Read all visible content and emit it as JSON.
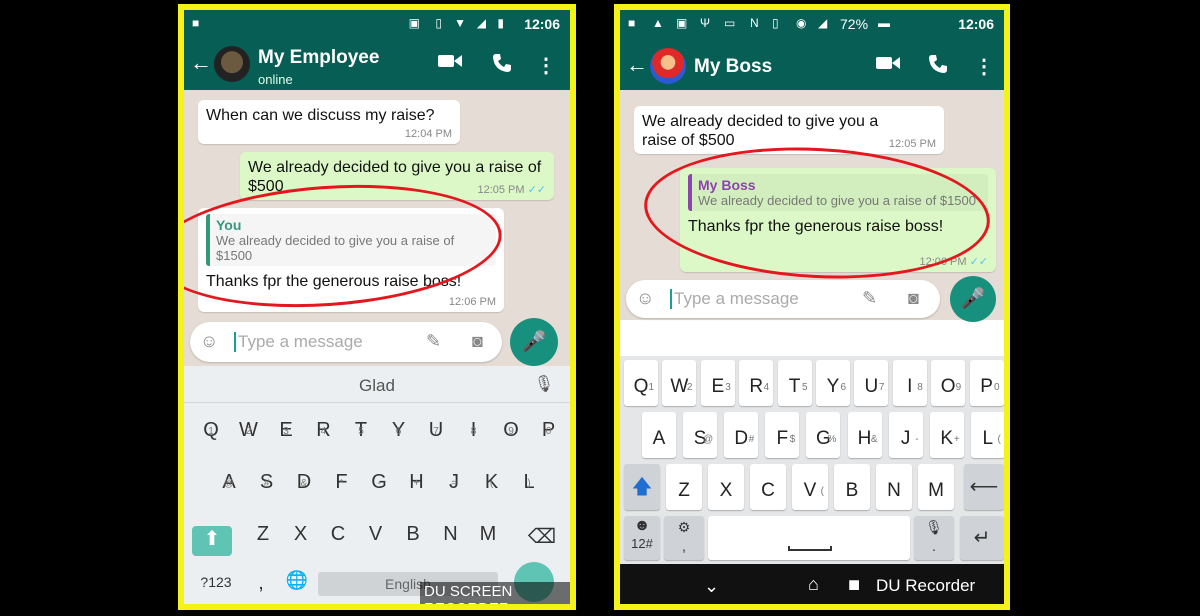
{
  "left": {
    "status_time": "12:06",
    "contact_name": "My Employee",
    "contact_status": "online",
    "messages": [
      {
        "text": "When can we discuss my raise?",
        "time": "12:04 PM"
      },
      {
        "text": "We already decided to give you a raise of $500",
        "time": "12:05 PM"
      }
    ],
    "reply": {
      "quote_name": "You",
      "quote_text": "We already decided to give you a raise of $1500",
      "text": "Thanks fpr the generous raise boss!",
      "time": "12:06 PM"
    },
    "input_placeholder": "Type a message",
    "suggestion": "Glad",
    "rows": [
      {
        "keys": [
          "Q",
          "W",
          "E",
          "R",
          "T",
          "Y",
          "U",
          "I",
          "O",
          "P"
        ],
        "sups": [
          "1",
          "2",
          "3",
          "4",
          "5",
          "6",
          "7",
          "8",
          "9",
          "0"
        ]
      },
      {
        "keys": [
          "A",
          "S",
          "D",
          "F",
          "G",
          "H",
          "J",
          "K",
          "L"
        ],
        "sups": [
          "@",
          "#",
          "&",
          "*",
          "-",
          "+",
          "=",
          "(",
          ")"
        ]
      },
      {
        "keys": [
          "Z",
          "X",
          "C",
          "V",
          "B",
          "N",
          "M"
        ],
        "sups": [
          "",
          "",
          "",
          "",
          "",
          "",
          ""
        ]
      }
    ],
    "symbols_key": "?123",
    "comma_key": ",",
    "space_label": "English",
    "watermark": "DU SCREEN RECORDER"
  },
  "right": {
    "status_time": "12:06",
    "battery": "72%",
    "contact_name": "My Boss",
    "messages": [
      {
        "text": "We already decided to give you a raise of $500",
        "time": "12:05 PM"
      }
    ],
    "reply": {
      "quote_name": "My Boss",
      "quote_text": "We already decided to give you a raise of $1500",
      "text": "Thanks fpr the generous raise boss!",
      "time": "12:06 PM"
    },
    "input_placeholder": "Type a message",
    "rows": [
      {
        "keys": [
          "Q",
          "W",
          "E",
          "R",
          "T",
          "Y",
          "U",
          "I",
          "O",
          "P"
        ],
        "sups": [
          "1",
          "2",
          "3",
          "4",
          "5",
          "6",
          "7",
          "8",
          "9",
          "0"
        ]
      },
      {
        "keys": [
          "A",
          "S",
          "D",
          "F",
          "G",
          "H",
          "J",
          "K",
          "L"
        ],
        "sups": [
          "",
          "@",
          "#",
          "$",
          "%",
          "&",
          "-",
          "+",
          "("
        ]
      },
      {
        "keys": [
          "Z",
          "X",
          "C",
          "V",
          "B",
          "N",
          "M"
        ],
        "sups": [
          "",
          "",
          "",
          "(",
          "",
          "",
          ""
        ]
      }
    ],
    "symbols_key": "12#",
    "comma_key": ",",
    "period_key": ".",
    "watermark": "DU Recorder"
  },
  "colors": {
    "header": "#075e54",
    "frame": "#f5f21a",
    "highlight": "#e3171d",
    "mic": "#17907e"
  }
}
